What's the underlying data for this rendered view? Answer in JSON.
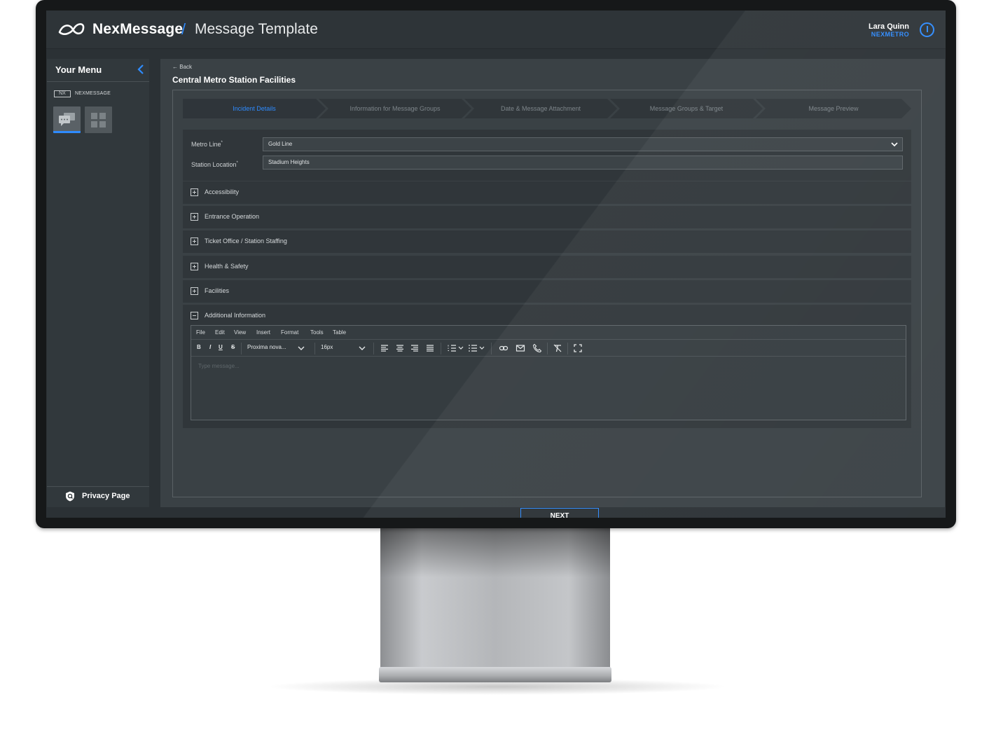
{
  "app": {
    "brand": "NexMessage",
    "separator": "/",
    "page_title": "Message Template"
  },
  "user": {
    "name": "Lara Quinn",
    "org": "NEXMETRO"
  },
  "sidebar": {
    "title": "Your Menu",
    "product_badge": "NX",
    "product_name": "NEXMESSAGE",
    "privacy_label": "Privacy Page"
  },
  "content": {
    "back_label": "Back",
    "form_title": "Central Metro Station Facilities",
    "steps": [
      {
        "label": "Incident Details",
        "active": true
      },
      {
        "label": "Information for Message Groups",
        "active": false
      },
      {
        "label": "Date & Message Attachment",
        "active": false
      },
      {
        "label": "Message Groups & Target",
        "active": false
      },
      {
        "label": "Message Preview",
        "active": false
      }
    ],
    "fields": {
      "metro_line_label": "Metro Line",
      "metro_line_value": "Gold Line",
      "station_location_label": "Station Location",
      "station_location_value": "Stadium Heights",
      "required_marker": "*"
    },
    "sections": [
      {
        "label": "Accessibility",
        "expanded": false
      },
      {
        "label": "Entrance Operation",
        "expanded": false
      },
      {
        "label": "Ticket Office / Station Staffing",
        "expanded": false
      },
      {
        "label": "Health & Safety",
        "expanded": false
      },
      {
        "label": "Facilities",
        "expanded": false
      },
      {
        "label": "Additional Information",
        "expanded": true
      }
    ],
    "editor": {
      "menu": [
        "File",
        "Edit",
        "View",
        "Insert",
        "Format",
        "Tools",
        "Table"
      ],
      "bold": "B",
      "italic": "I",
      "underline": "U",
      "strike": "S",
      "font": "Proxima nova...",
      "size": "16px",
      "placeholder": "Type message..."
    },
    "next_label": "NEXT"
  },
  "colors": {
    "accent": "#2e8bff",
    "background": "#2b3135",
    "panel": "#30363a"
  }
}
